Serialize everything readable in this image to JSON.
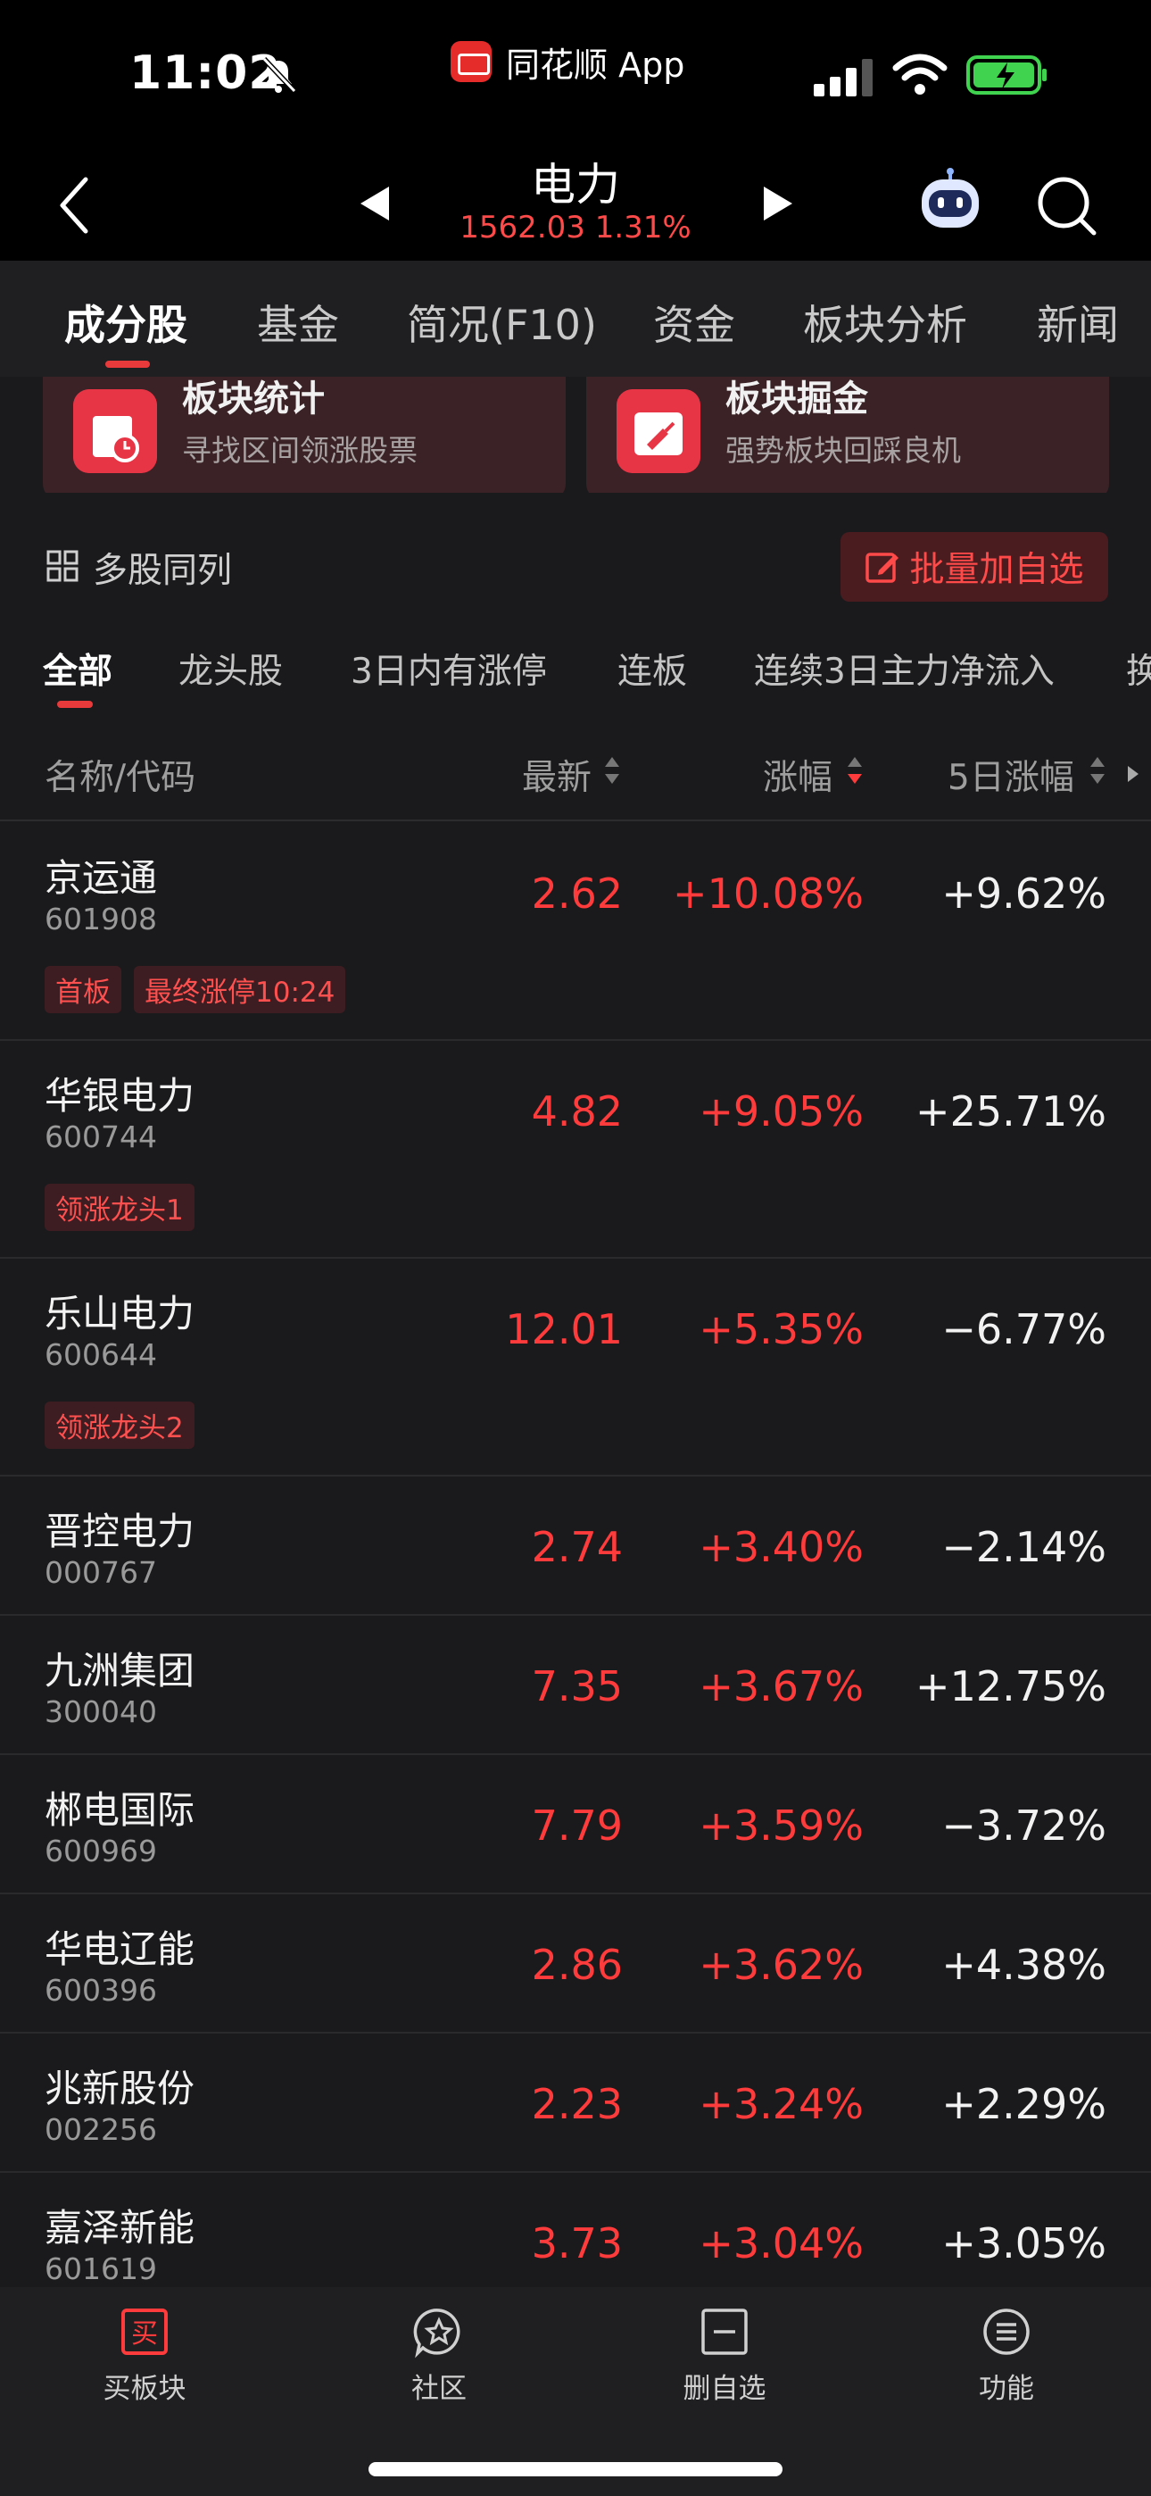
{
  "status_bar": {
    "time": "11:02",
    "app_name": "同花顺 App"
  },
  "header": {
    "title": "电力",
    "subtitle": "1562.03 1.31%"
  },
  "main_tabs": [
    "成分股",
    "基金",
    "简况(F10)",
    "资金",
    "板块分析",
    "新闻"
  ],
  "cards": [
    {
      "title": "板块统计",
      "desc": "寻找区间领涨股票"
    },
    {
      "title": "板块掘金",
      "desc": "强势板块回踩良机"
    }
  ],
  "multi_list_label": "多股同列",
  "batch_add_label": "批量加自选",
  "filters": [
    "全部",
    "龙头股",
    "3日内有涨停",
    "连板",
    "连续3日主力净流入",
    "换"
  ],
  "columns": {
    "name": "名称/代码",
    "price": "最新",
    "change": "涨幅",
    "five_day": "5日涨幅"
  },
  "stocks": [
    {
      "name": "京运通",
      "code": "601908",
      "price": "2.62",
      "change": "+10.08%",
      "five_day": "+9.62%",
      "tags": [
        "首板",
        "最终涨停10:24"
      ]
    },
    {
      "name": "华银电力",
      "code": "600744",
      "price": "4.82",
      "change": "+9.05%",
      "five_day": "+25.71%",
      "tags": [
        "领涨龙头1"
      ]
    },
    {
      "name": "乐山电力",
      "code": "600644",
      "price": "12.01",
      "change": "+5.35%",
      "five_day": "−6.77%",
      "tags": [
        "领涨龙头2"
      ]
    },
    {
      "name": "晋控电力",
      "code": "000767",
      "price": "2.74",
      "change": "+3.40%",
      "five_day": "−2.14%",
      "tags": []
    },
    {
      "name": "九洲集团",
      "code": "300040",
      "price": "7.35",
      "change": "+3.67%",
      "five_day": "+12.75%",
      "tags": []
    },
    {
      "name": "郴电国际",
      "code": "600969",
      "price": "7.79",
      "change": "+3.59%",
      "five_day": "−3.72%",
      "tags": []
    },
    {
      "name": "华电辽能",
      "code": "600396",
      "price": "2.86",
      "change": "+3.62%",
      "five_day": "+4.38%",
      "tags": []
    },
    {
      "name": "兆新股份",
      "code": "002256",
      "price": "2.23",
      "change": "+3.24%",
      "five_day": "+2.29%",
      "tags": []
    },
    {
      "name": "嘉泽新能",
      "code": "601619",
      "price": "3.73",
      "change": "+3.04%",
      "five_day": "+3.05%",
      "tags": []
    }
  ],
  "bottom_nav": [
    {
      "label": "买板块",
      "icon": "buy-icon"
    },
    {
      "label": "社区",
      "icon": "community-icon"
    },
    {
      "label": "删自选",
      "icon": "remove-watchlist-icon"
    },
    {
      "label": "功能",
      "icon": "menu-icon"
    }
  ],
  "colors": {
    "up": "#ff3b3b",
    "accent": "#e83a3a",
    "background": "#1a1a1c"
  }
}
